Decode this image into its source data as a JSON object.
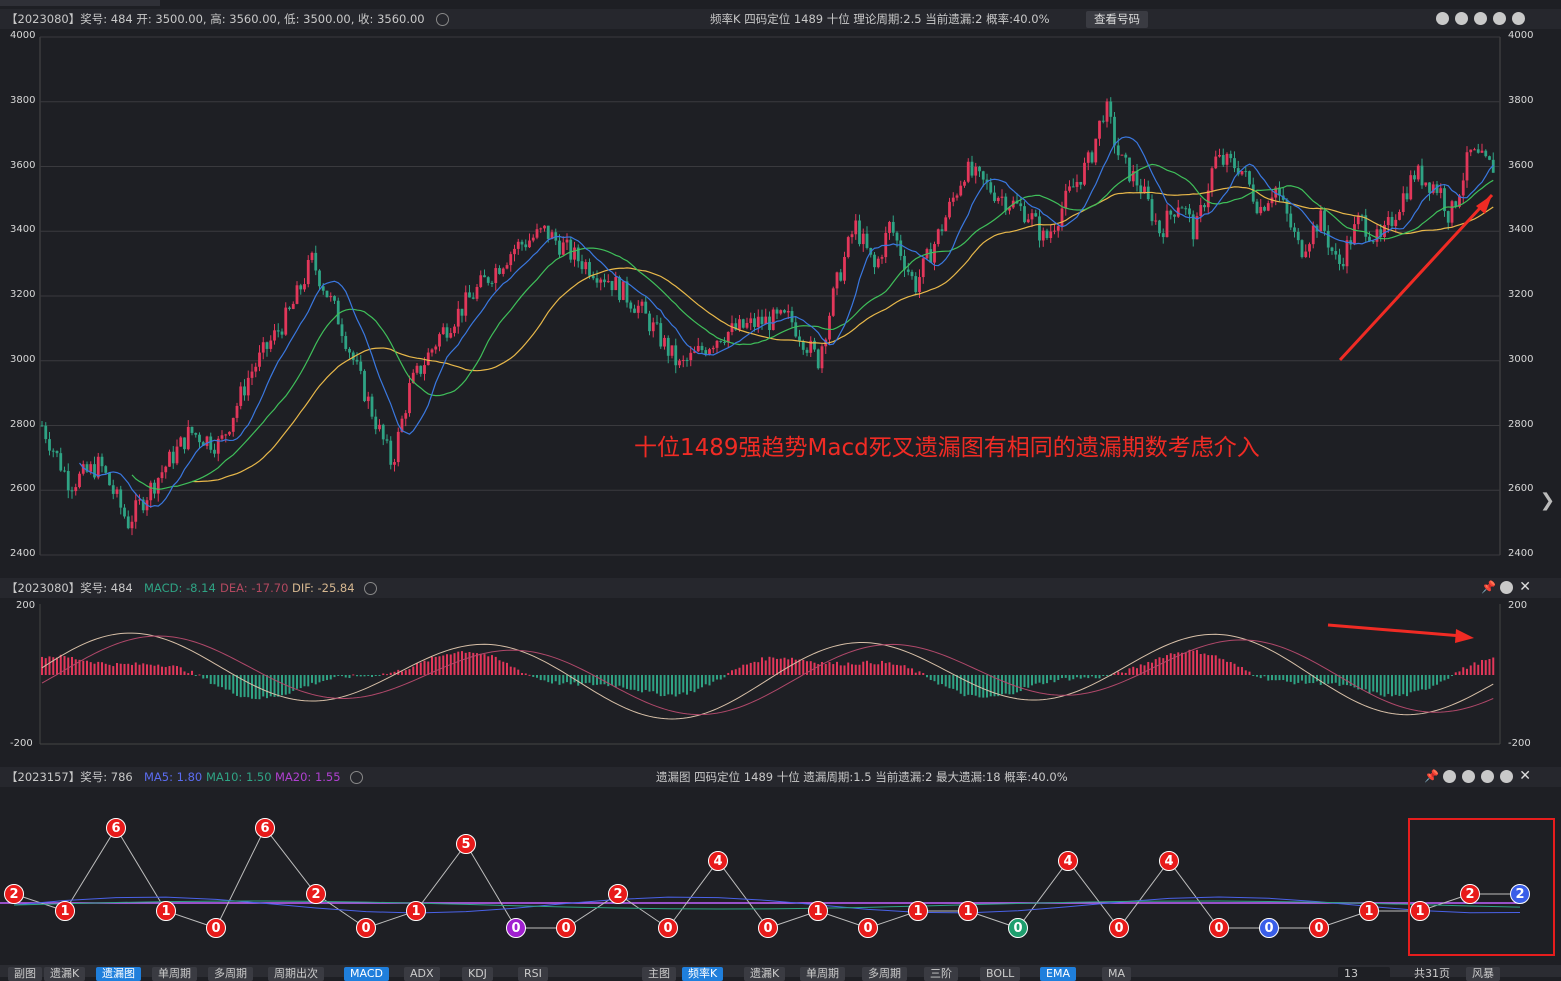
{
  "top": {
    "info": "【2023080】奖号: 484  开: 3500.00, 高: 3560.00, 低: 3500.00, 收: 3560.00",
    "center": "频率K   四码定位   1489   十位   理论周期:2.5   当前遗漏:2   概率:40.0%",
    "button": "查看号码"
  },
  "main_axis": [
    "4000",
    "3800",
    "3600",
    "3400",
    "3200",
    "3000",
    "2800",
    "2600",
    "2400"
  ],
  "annotation": "十位1489强趋势Macd死叉遗漏图有相同的遗漏期数考虑介入",
  "macd": {
    "prefix": "【2023080】奖号: 484",
    "macd_label": "MACD: -8.14",
    "dea_label": "DEA: -17.70",
    "dif_label": "DIF: -25.84",
    "axis_top": "200",
    "axis_bottom": "-200"
  },
  "miss": {
    "prefix": "【2023157】奖号: 786",
    "ma5": "MA5: 1.80",
    "ma10": "MA10: 1.50",
    "ma20": "MA20: 1.55",
    "center": "遗漏图   四码定位   1489   十位   遗漏周期:1.5   当前遗漏:2   最大遗漏:18   概率:40.0%",
    "values": [
      "2",
      "1",
      "6",
      "1",
      "0",
      "6",
      "2",
      "0",
      "1",
      "5",
      "0",
      "0",
      "2",
      "0",
      "4",
      "0",
      "1",
      "0",
      "1",
      "1",
      "0",
      "4",
      "0",
      "4",
      "0",
      "0",
      "0",
      "1",
      "1",
      "2",
      "2"
    ]
  },
  "bottom_tabs": {
    "left": [
      "副图",
      "遗漏K",
      "遗漏图",
      "单周期",
      "多周期",
      "周期出次",
      "MACD",
      "ADX",
      "KDJ",
      "RSI"
    ],
    "right": [
      "主图",
      "频率K",
      "遗漏K",
      "单周期",
      "多周期",
      "三阶",
      "BOLL",
      "EMA",
      "MA"
    ],
    "page_value": "13",
    "page_total": "共31页",
    "fullscreen": "风暴"
  },
  "colors": {
    "up": "#e2375a",
    "down": "#2fa384",
    "ma_blue": "#3a78e0",
    "ma_green": "#3fbf5a",
    "ma_yellow": "#e8b84a",
    "annotation": "#f02b24"
  }
}
